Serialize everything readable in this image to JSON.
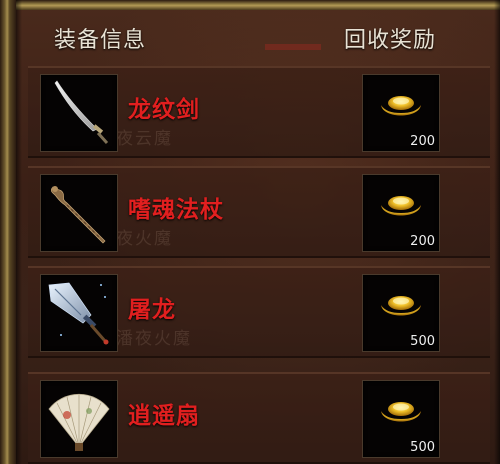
{
  "header": {
    "equipment_info": "装备信息",
    "recycle_reward": "回收奖励"
  },
  "rows": [
    {
      "name": "龙纹剑",
      "reward_amount": "200",
      "item_icon": "curved-sword-icon",
      "reward_icon": "gold-ingot-icon",
      "watermark": "夜云魔"
    },
    {
      "name": "嗜魂法杖",
      "reward_amount": "200",
      "item_icon": "staff-icon",
      "reward_icon": "gold-ingot-icon",
      "watermark": "夜火魔"
    },
    {
      "name": "屠龙",
      "reward_amount": "500",
      "item_icon": "dragon-slayer-blade-icon",
      "reward_icon": "gold-ingot-icon",
      "watermark": "潘夜火魔"
    },
    {
      "name": "逍遥扇",
      "reward_amount": "500",
      "item_icon": "fan-icon",
      "reward_icon": "gold-ingot-icon",
      "watermark": ""
    }
  ],
  "colors": {
    "item_name": "#e11f1f",
    "header_text": "#e8e2d4",
    "gold_border": "#a48d4e"
  }
}
